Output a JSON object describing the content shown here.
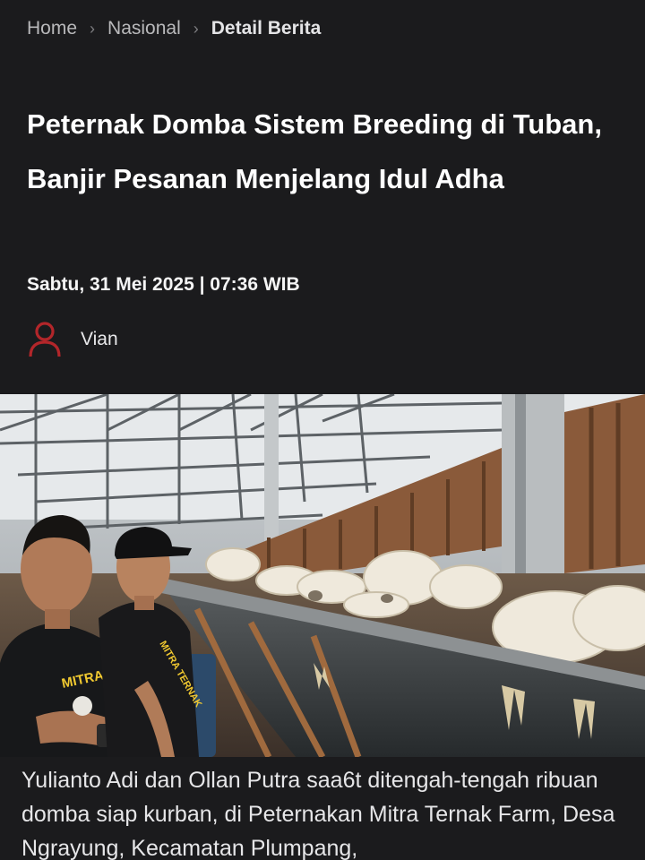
{
  "breadcrumb": {
    "home": "Home",
    "section": "Nasional",
    "current": "Detail Berita",
    "separator": "›"
  },
  "article": {
    "title": "Peternak Domba Sistem Breeding di Tuban, Banjir Pesanan Menjelang Idul Adha",
    "date": "Sabtu, 31 Mei 2025 | 07:36 WIB",
    "author": "Vian",
    "photo_shirt_text": "MITRA TERNAK",
    "caption": "Yulianto Adi dan Ollan Putra saa6t ditengah-tengah ribuan domba siap kurban, di Peternakan Mitra Ternak Farm, Desa Ngrayung, Kecamatan Plumpang,"
  },
  "colors": {
    "background": "#1b1b1d",
    "author_icon": "#b3262a",
    "shirt_text": "#f0c830"
  },
  "icons": {
    "author": "user-icon"
  }
}
